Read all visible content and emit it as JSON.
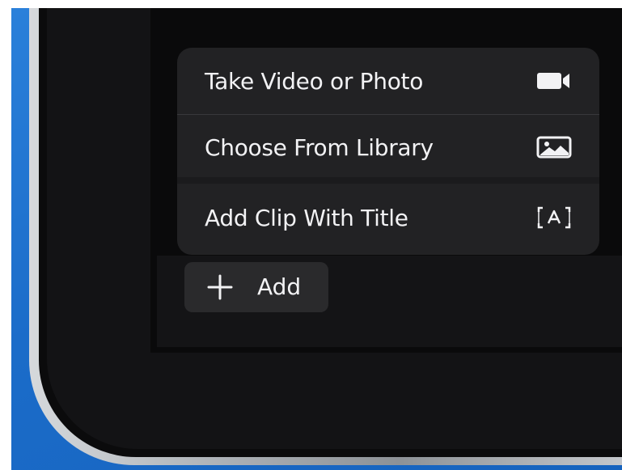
{
  "colors": {
    "menu_background": "#222224",
    "menu_text": "#f2f2f4",
    "add_button_background": "#2a2a2c",
    "backdrop_blue": "#1b6cc9"
  },
  "menu": {
    "items": [
      {
        "label": "Take Video or Photo",
        "icon": "video-camera-icon"
      },
      {
        "label": "Choose From Library",
        "icon": "photo-library-icon"
      },
      {
        "label": "Add Clip With Title",
        "icon": "title-card-icon"
      }
    ]
  },
  "add_button": {
    "label": "Add",
    "icon": "plus-icon"
  }
}
